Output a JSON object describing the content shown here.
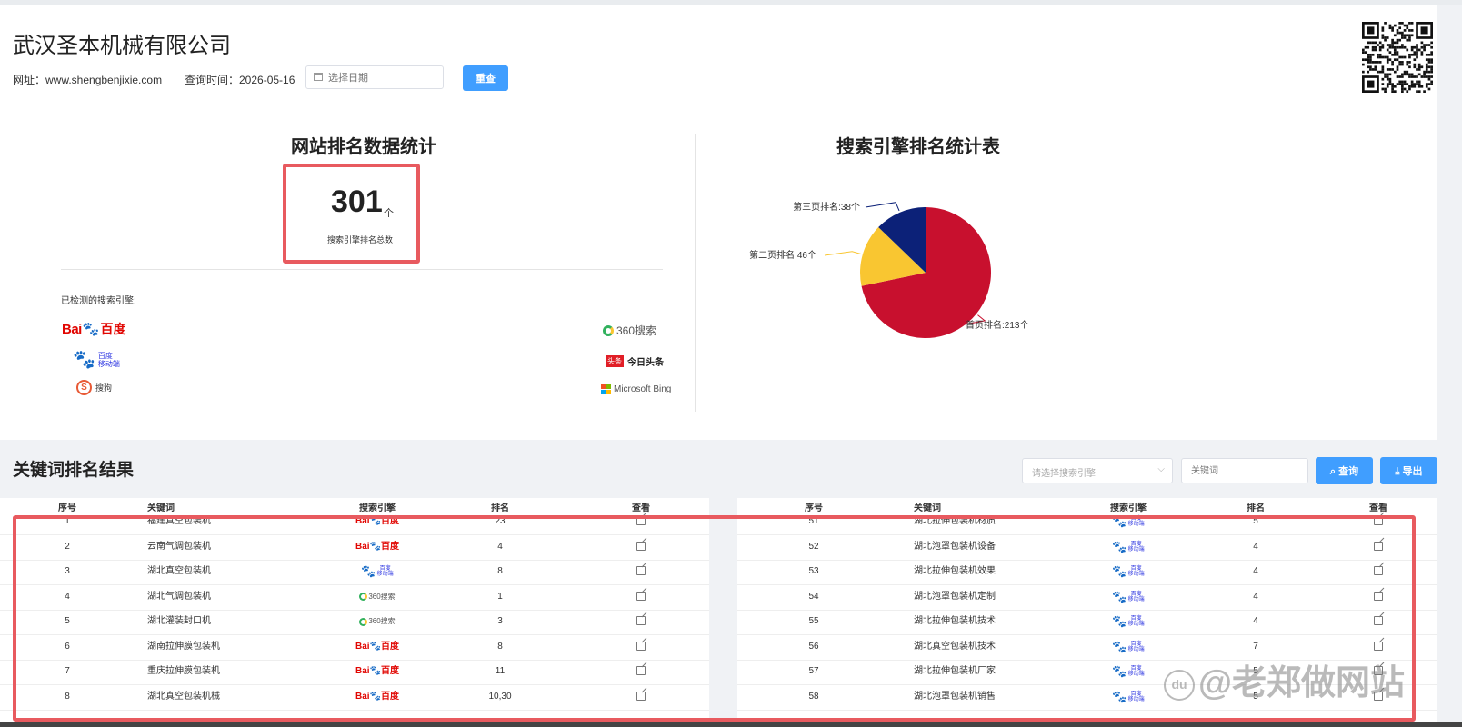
{
  "header": {
    "company": "武汉圣本机械有限公司",
    "url_label": "网址：www.shengbenjixie.com",
    "time_label": "查询时间：2026-05-16",
    "date_placeholder": "选择日期",
    "reset_label": "重查"
  },
  "stats": {
    "title": "网站排名数据统计",
    "total": "301",
    "unit": "个",
    "total_label": "搜索引擎排名总数",
    "detected_label": "已检测的搜索引擎:",
    "engines": {
      "baidu_a": "Bai",
      "baidu_b": "百度",
      "baidu_mobile_a": "百度",
      "baidu_mobile_b": "移动端",
      "so": "360搜索",
      "toutiao_box": "头条",
      "toutiao": "今日头条",
      "bing": "Microsoft Bing",
      "sogou_mark": "S",
      "sogou": "搜狗"
    }
  },
  "chart": {
    "title": "搜索引擎排名统计表"
  },
  "chart_data": {
    "type": "pie",
    "title": "搜索引擎排名统计表",
    "slices": [
      {
        "label": "首页排名:213个",
        "value": 213,
        "color": "#c8102e"
      },
      {
        "label": "第二页排名:46个",
        "value": 46,
        "color": "#f9c631"
      },
      {
        "label": "第三页排名:38个",
        "value": 38,
        "color": "#0c2178"
      }
    ]
  },
  "keywords": {
    "title": "关键词排名结果",
    "engine_select_placeholder": "请选择搜索引擎",
    "keyword_placeholder": "关键词",
    "search_label": "查询",
    "export_label": "导出",
    "columns": [
      "序号",
      "关键词",
      "搜索引擎",
      "排名",
      "查看"
    ],
    "left_rows": [
      {
        "no": "1",
        "keyword": "福建真空包装机",
        "engine": "baidu",
        "rank": "23"
      },
      {
        "no": "2",
        "keyword": "云南气调包装机",
        "engine": "baidu",
        "rank": "4"
      },
      {
        "no": "3",
        "keyword": "湖北真空包装机",
        "engine": "baidu_mobile",
        "rank": "8"
      },
      {
        "no": "4",
        "keyword": "湖北气调包装机",
        "engine": "so",
        "rank": "1"
      },
      {
        "no": "5",
        "keyword": "湖北灌装封口机",
        "engine": "so",
        "rank": "3"
      },
      {
        "no": "6",
        "keyword": "湖南拉伸膜包装机",
        "engine": "baidu",
        "rank": "8"
      },
      {
        "no": "7",
        "keyword": "重庆拉伸膜包装机",
        "engine": "baidu",
        "rank": "11"
      },
      {
        "no": "8",
        "keyword": "湖北真空包装机械",
        "engine": "baidu",
        "rank": "10,30"
      }
    ],
    "right_rows": [
      {
        "no": "51",
        "keyword": "湖北拉伸包装机材质",
        "engine": "baidu_mobile",
        "rank": "5"
      },
      {
        "no": "52",
        "keyword": "湖北泡罩包装机设备",
        "engine": "baidu_mobile",
        "rank": "4"
      },
      {
        "no": "53",
        "keyword": "湖北拉伸包装机效果",
        "engine": "baidu_mobile",
        "rank": "4"
      },
      {
        "no": "54",
        "keyword": "湖北泡罩包装机定制",
        "engine": "baidu_mobile",
        "rank": "4"
      },
      {
        "no": "55",
        "keyword": "湖北拉伸包装机技术",
        "engine": "baidu_mobile",
        "rank": "4"
      },
      {
        "no": "56",
        "keyword": "湖北真空包装机技术",
        "engine": "baidu_mobile",
        "rank": "7"
      },
      {
        "no": "57",
        "keyword": "湖北拉伸包装机厂家",
        "engine": "baidu_mobile",
        "rank": "5"
      },
      {
        "no": "58",
        "keyword": "湖北泡罩包装机销售",
        "engine": "baidu_mobile",
        "rank": "5"
      }
    ]
  },
  "watermark": {
    "mark": "du",
    "text": "@老郑做网站"
  }
}
